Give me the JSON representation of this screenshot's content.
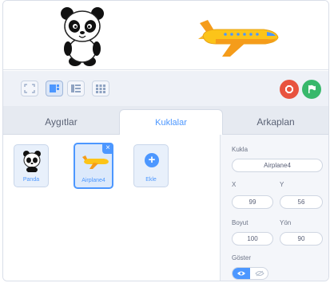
{
  "stage": {
    "sprites": [
      "panda",
      "airplane"
    ]
  },
  "toolbar": {
    "modes": [
      "fullscreen-icon",
      "large-stage-icon",
      "small-stage-icon",
      "grid-icon"
    ],
    "stop_color": "#e8533f",
    "go_color": "#38b86b"
  },
  "tabs": [
    {
      "label": "Aygıtlar"
    },
    {
      "label": "Kuklalar"
    },
    {
      "label": "Arkaplan"
    }
  ],
  "sprites": [
    {
      "label": "Panda"
    },
    {
      "label": "Airplane4"
    },
    {
      "label": "Ekle"
    }
  ],
  "info": {
    "sprite_label": "Kukla",
    "sprite_name": "Airplane4",
    "x_label": "X",
    "y_label": "Y",
    "x_value": "99",
    "y_value": "56",
    "size_label": "Boyut",
    "direction_label": "Yön",
    "size_value": "100",
    "direction_value": "90",
    "show_label": "Göster"
  },
  "accent": "#4c97ff"
}
